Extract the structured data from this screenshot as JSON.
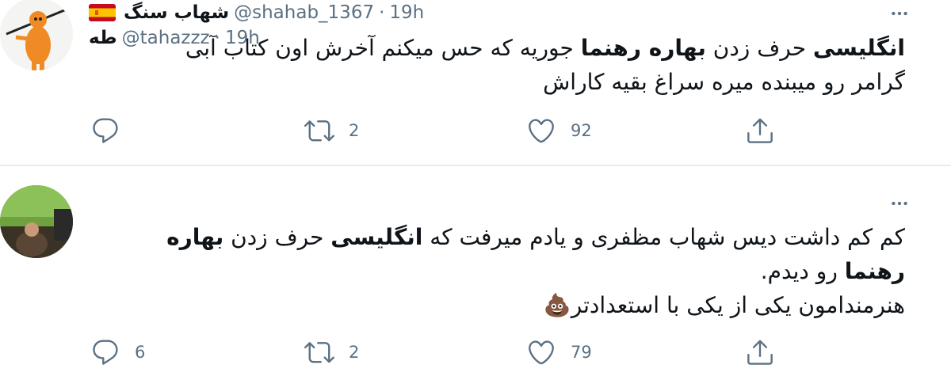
{
  "tweets": [
    {
      "display_name": "شهاب سنگ",
      "handle": "@shahab_1367",
      "separator": "·",
      "time": "19h",
      "lines": [
        [
          {
            "text": "انگلیسی",
            "bold": true
          },
          {
            "text": " حرف زدن ",
            "bold": false
          },
          {
            "text": "بهاره رهنما",
            "bold": true
          },
          {
            "text": " جوریه که حس میکنم آخرش اون کتاب آبی",
            "bold": false
          }
        ],
        [
          {
            "text": "گرامر رو میبنده میره سراغ بقیه کاراش",
            "bold": false
          }
        ]
      ],
      "reply_count": "",
      "retweet_count": "2",
      "like_count": "92",
      "has_flag": true
    },
    {
      "display_name": "طه",
      "handle": "@tahazzz",
      "separator": "·",
      "time": "19h",
      "lines": [
        [
          {
            "text": "کم کم داشت دیس شهاب مظفری و یادم میرفت که ",
            "bold": false
          },
          {
            "text": "انگلیسی",
            "bold": true
          },
          {
            "text": " حرف زدن ",
            "bold": false
          },
          {
            "text": "بهاره",
            "bold": true
          }
        ],
        [
          {
            "text": "رهنما",
            "bold": true
          },
          {
            "text": " رو دیدم.",
            "bold": false
          }
        ],
        [
          {
            "text": "هنرمندامون یکی از یکی با استعدادتر",
            "bold": false
          },
          {
            "text": "💩",
            "bold": false
          }
        ]
      ],
      "reply_count": "6",
      "retweet_count": "2",
      "like_count": "79",
      "has_flag": false
    }
  ],
  "icons": {
    "more": "more-icon",
    "reply": "reply-icon",
    "retweet": "retweet-icon",
    "like": "like-icon",
    "share": "share-icon",
    "flag": "spain-flag-icon"
  },
  "colors": {
    "text": "#0f1419",
    "secondary": "#5b7083",
    "divider": "#e6ecf0"
  }
}
